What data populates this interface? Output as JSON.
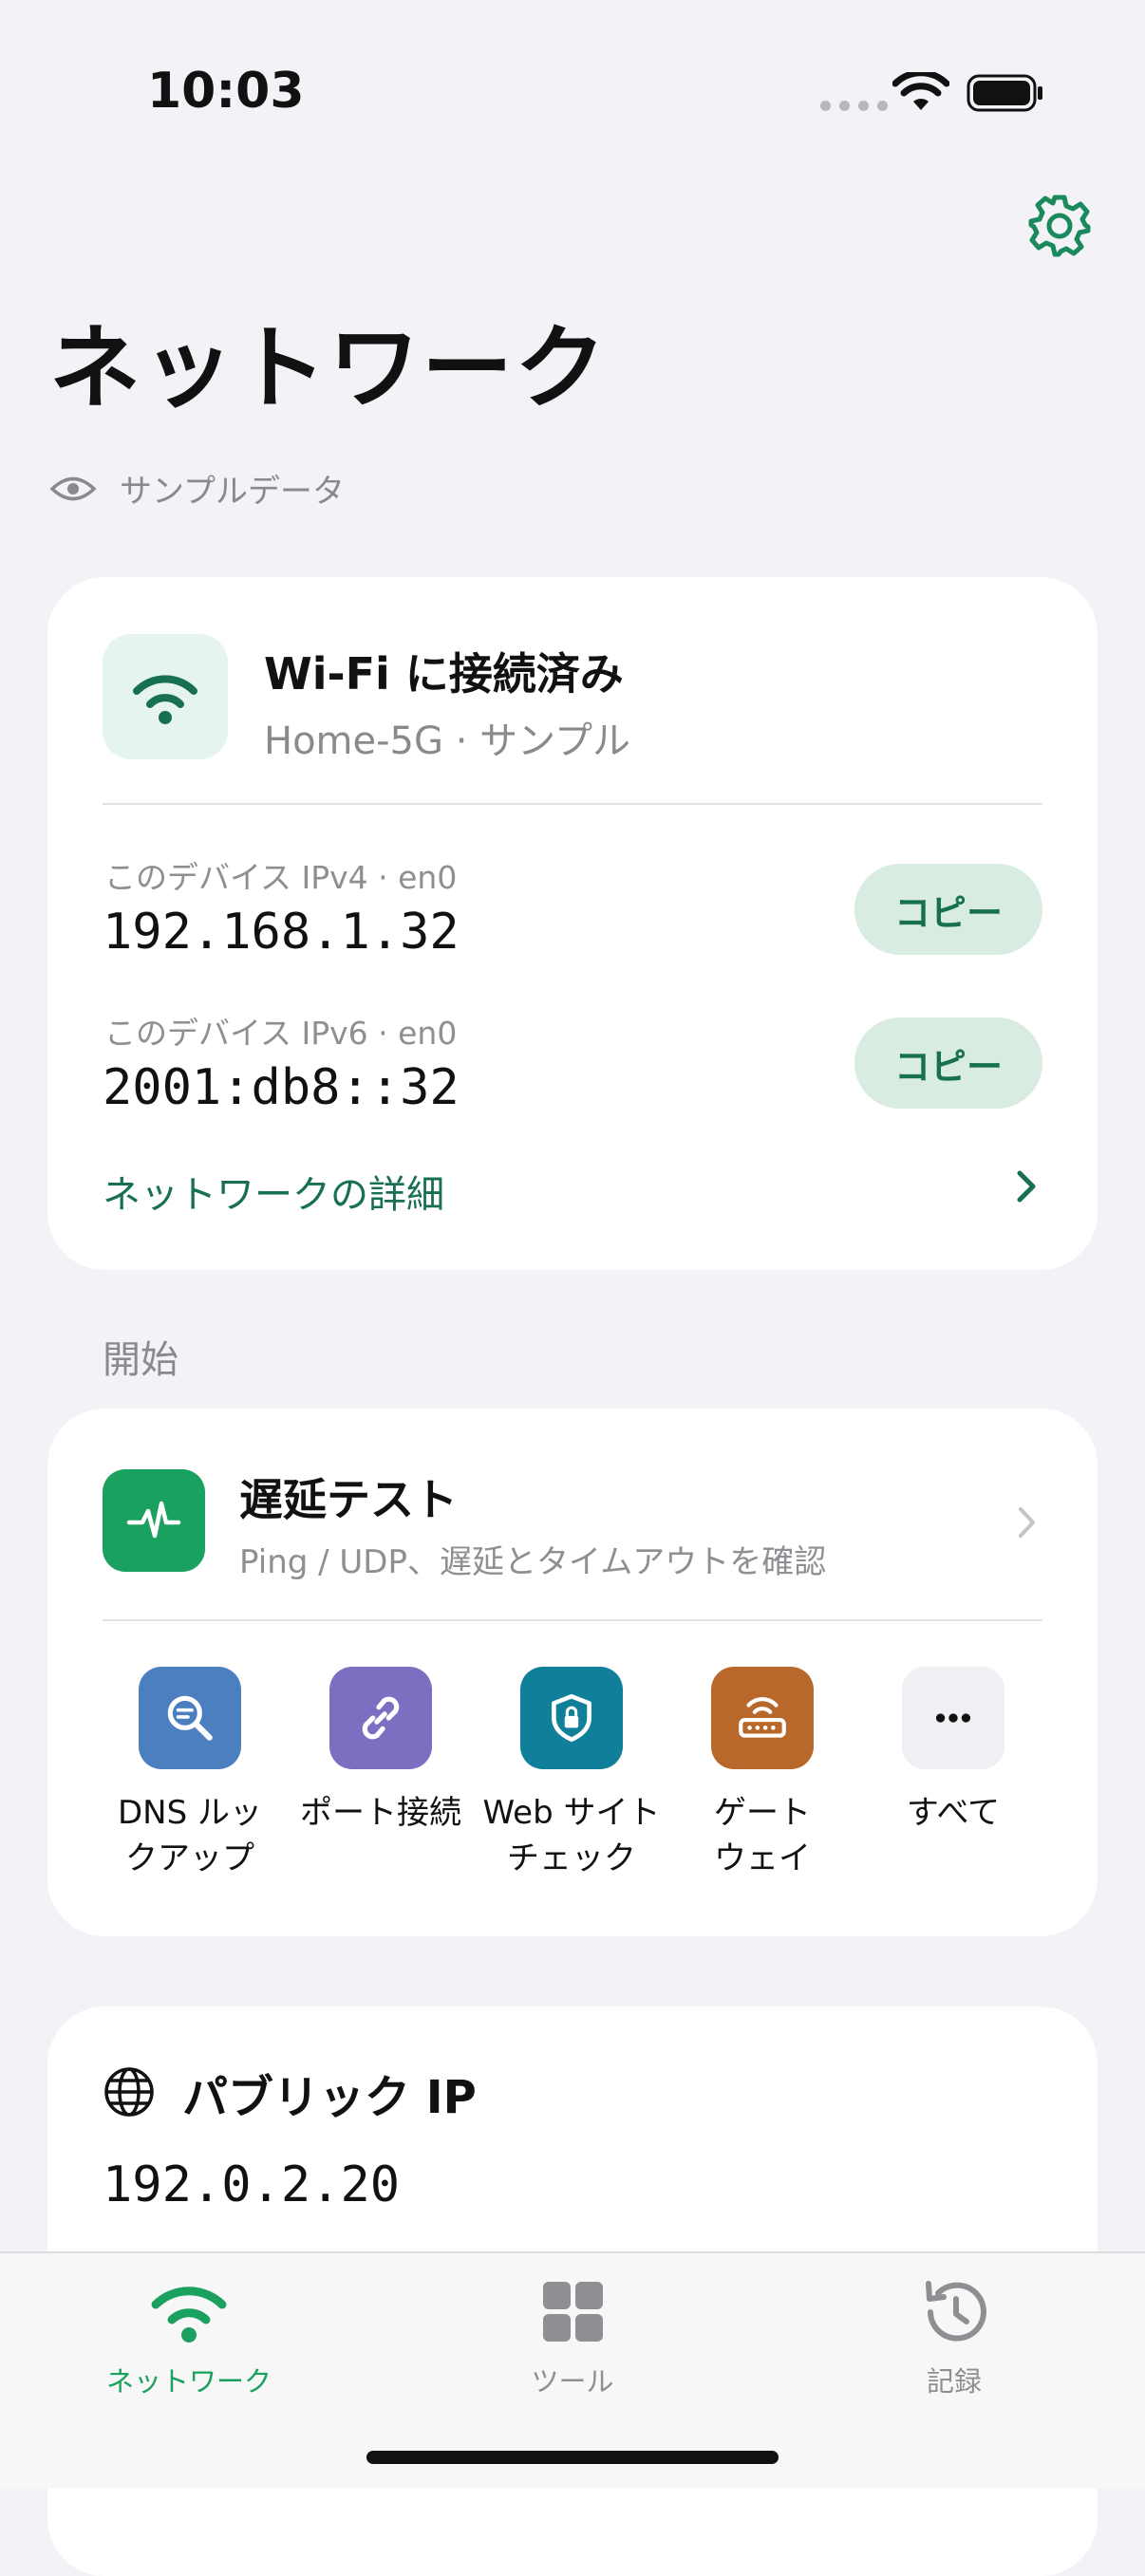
{
  "status_bar": {
    "time": "10:03"
  },
  "header": {
    "title": "ネットワーク",
    "sample_label": "サンプルデータ"
  },
  "connection": {
    "title": "Wi-Fi に接続済み",
    "subtitle": "Home-5G · サンプル",
    "ipv4": {
      "label": "このデバイス IPv4 · en0",
      "value": "192.168.1.32",
      "copy_label": "コピー"
    },
    "ipv6": {
      "label": "このデバイス IPv6 · en0",
      "value": "2001:db8::32",
      "copy_label": "コピー"
    },
    "details_link": "ネットワークの詳細"
  },
  "start_section": {
    "label": "開始",
    "latency": {
      "title": "遅延テスト",
      "subtitle": "Ping / UDP、遅延とタイムアウトを確認"
    },
    "tools": [
      {
        "label_line1": "DNS ルッ",
        "label_line2": "クアップ",
        "icon": "dns-lookup-icon",
        "color": "#4b7fc0"
      },
      {
        "label_line1": "ポート接続",
        "label_line2": "",
        "icon": "link-icon",
        "color": "#7d6ec2"
      },
      {
        "label_line1": "Web サイト",
        "label_line2": "チェック",
        "icon": "shield-lock-icon",
        "color": "#0f7f9a"
      },
      {
        "label_line1": "ゲート",
        "label_line2": "ウェイ",
        "icon": "router-icon",
        "color": "#b8682a"
      },
      {
        "label_line1": "すべて",
        "label_line2": "",
        "icon": "more-icon",
        "color": "#f0f0f4"
      }
    ]
  },
  "public_ip": {
    "title": "パブリック IP",
    "value": "192.0.2.20"
  },
  "tabbar": {
    "tabs": [
      {
        "label": "ネットワーク",
        "active": true
      },
      {
        "label": "ツール",
        "active": false
      },
      {
        "label": "記録",
        "active": false
      }
    ]
  },
  "colors": {
    "accent": "#17704f",
    "active_tab": "#1aa160",
    "inactive_tab": "#8e8e93"
  }
}
